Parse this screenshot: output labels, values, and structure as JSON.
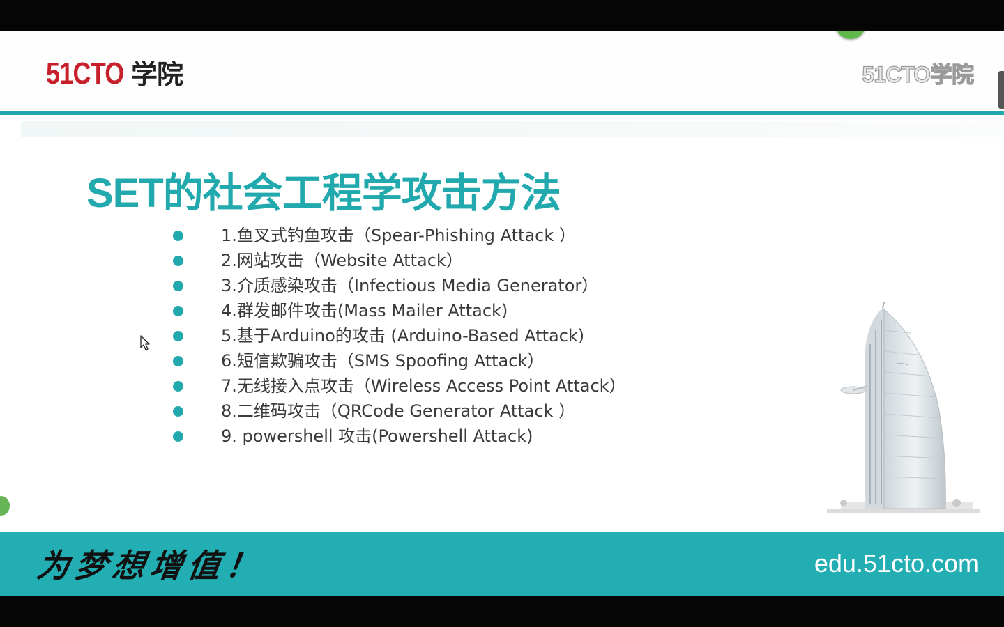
{
  "brand": {
    "logo_number": "51CTO",
    "logo_text": "学院",
    "logo_watermark": "51CTO学院",
    "brand_red": "#c8202b",
    "accent_teal": "#21a9ad"
  },
  "slide": {
    "title": "SET的社会工程学攻击方法",
    "items": [
      {
        "label": "1.鱼叉式钓鱼攻击（Spear-Phishing  Attack  ）"
      },
      {
        "label": "2.网站攻击（Website  Attack）"
      },
      {
        "label": "3.介质感染攻击（Infectious  Media Generator）"
      },
      {
        "label": "4.群发邮件攻击(Mass  Mailer  Attack)"
      },
      {
        "label": "5.基于Arduino的攻击 (Arduino-Based  Attack)"
      },
      {
        "label": "6.短信欺骗攻击（SMS  Spoofing Attack）"
      },
      {
        "label": "7.无线接入点攻击（Wireless  Access  Point Attack）"
      },
      {
        "label": "8.二维码攻击（QRCode  Generator  Attack  ）"
      },
      {
        "label": "9. powershell 攻击(Powershell  Attack)"
      }
    ]
  },
  "footer": {
    "slogan": "为梦想增值！",
    "site": "edu.51cto.com"
  },
  "icons": {
    "cursor": "arrow-cursor-icon",
    "bullet": "teal-dot-icon",
    "building": "burj-al-arab-illustration"
  }
}
